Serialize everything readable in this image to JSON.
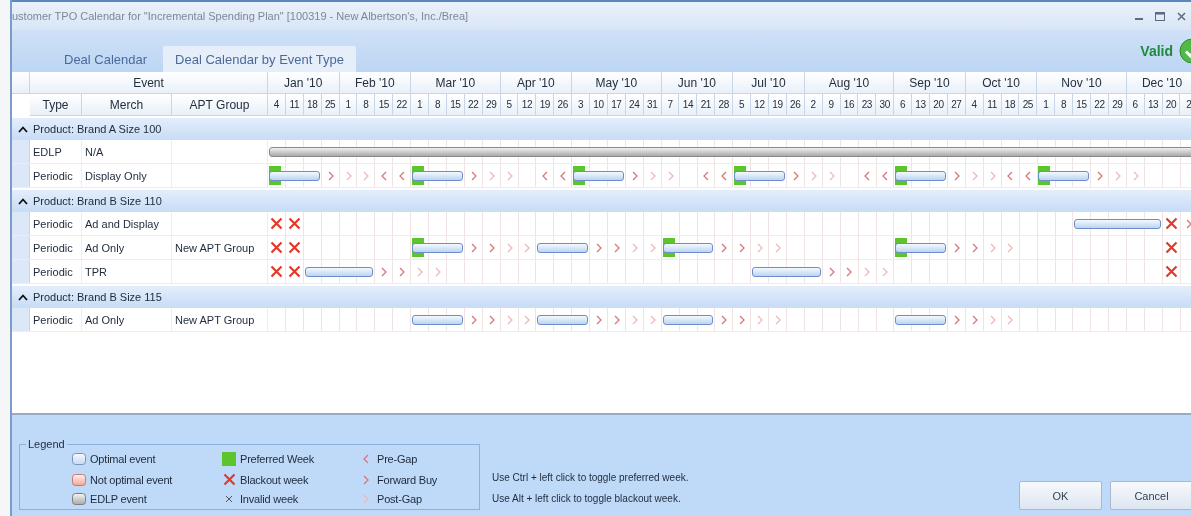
{
  "window": {
    "title": "ustomer TPO Calendar for \"Incremental Spending Plan\" [100319 - New Albertson's, Inc./Brea]"
  },
  "tabs": [
    {
      "label": "Deal Calendar",
      "selected": false
    },
    {
      "label": "Deal Calendar by Event Type",
      "selected": true
    }
  ],
  "status": {
    "label": "Valid",
    "valid": true
  },
  "table": {
    "event_header": "Event",
    "columns": [
      "Type",
      "Merch",
      "APT Group"
    ],
    "months": [
      {
        "label": "Jan '10",
        "weeks": [
          "4",
          "11",
          "18",
          "25"
        ]
      },
      {
        "label": "Feb '10",
        "weeks": [
          "1",
          "8",
          "15",
          "22"
        ]
      },
      {
        "label": "Mar '10",
        "weeks": [
          "1",
          "8",
          "15",
          "22",
          "29"
        ]
      },
      {
        "label": "Apr '10",
        "weeks": [
          "5",
          "12",
          "19",
          "26"
        ]
      },
      {
        "label": "May '10",
        "weeks": [
          "3",
          "10",
          "17",
          "24",
          "31"
        ]
      },
      {
        "label": "Jun '10",
        "weeks": [
          "7",
          "14",
          "21",
          "28"
        ]
      },
      {
        "label": "Jul '10",
        "weeks": [
          "5",
          "12",
          "19",
          "26"
        ]
      },
      {
        "label": "Aug '10",
        "weeks": [
          "2",
          "9",
          "16",
          "23",
          "30"
        ]
      },
      {
        "label": "Sep '10",
        "weeks": [
          "6",
          "13",
          "20",
          "27"
        ]
      },
      {
        "label": "Oct '10",
        "weeks": [
          "4",
          "11",
          "18",
          "25"
        ]
      },
      {
        "label": "Nov '10",
        "weeks": [
          "1",
          "8",
          "15",
          "22",
          "29"
        ]
      },
      {
        "label": "Dec '10",
        "weeks": [
          "6",
          "13",
          "20",
          "2"
        ]
      }
    ],
    "groups": [
      {
        "label": "Product: Brand A Size 100",
        "expanded": true,
        "rows": [
          {
            "type": "EDLP",
            "merch": "N/A",
            "weeks": [
              {
                "kind": "edlp"
              },
              {
                "kind": "cont"
              },
              {
                "kind": "cont"
              },
              {
                "kind": "cont"
              },
              {
                "kind": "cont"
              },
              {
                "kind": "cont"
              },
              {
                "kind": "cont"
              },
              {
                "kind": "cont"
              },
              {
                "kind": "cont"
              },
              {
                "kind": "cont"
              },
              {
                "kind": "cont"
              },
              {
                "kind": "cont"
              },
              {
                "kind": "cont"
              },
              {
                "kind": "cont"
              },
              {
                "kind": "cont"
              },
              {
                "kind": "cont"
              },
              {
                "kind": "cont"
              },
              {
                "kind": "cont"
              },
              {
                "kind": "cont"
              },
              {
                "kind": "cont"
              },
              {
                "kind": "cont"
              },
              {
                "kind": "cont"
              },
              {
                "kind": "cont"
              },
              {
                "kind": "cont"
              },
              {
                "kind": "cont"
              },
              {
                "kind": "cont"
              },
              {
                "kind": "cont"
              },
              {
                "kind": "cont"
              },
              {
                "kind": "cont"
              },
              {
                "kind": "cont"
              },
              {
                "kind": "cont"
              },
              {
                "kind": "cont"
              },
              {
                "kind": "cont"
              },
              {
                "kind": "cont"
              },
              {
                "kind": "cont"
              },
              {
                "kind": "cont"
              },
              {
                "kind": "cont"
              },
              {
                "kind": "cont"
              },
              {
                "kind": "cont"
              },
              {
                "kind": "cont"
              },
              {
                "kind": "cont"
              },
              {
                "kind": "cont"
              },
              {
                "kind": "cont"
              },
              {
                "kind": "cont"
              },
              {
                "kind": "cont"
              },
              {
                "kind": "cont"
              },
              {
                "kind": "cont"
              },
              {
                "kind": "cont"
              },
              {
                "kind": "cont"
              },
              {
                "kind": "cont"
              },
              {
                "kind": "cont"
              },
              {
                "kind": "cont"
              }
            ]
          },
          {
            "type": "Periodic",
            "merch": "Display Only",
            "weeks": [
              {
                "kind": "preferred"
              },
              {
                "kind": "cont"
              },
              {
                "kind": "cont"
              },
              {
                "kind": "fwd"
              },
              {
                "kind": "post"
              },
              {
                "kind": "post"
              },
              {
                "kind": "pre"
              },
              {
                "kind": "pre"
              },
              {
                "kind": "preferred"
              },
              {
                "kind": "cont"
              },
              {
                "kind": "cont"
              },
              {
                "kind": "fwd"
              },
              {
                "kind": "post"
              },
              {
                "kind": "post"
              },
              {
                "kind": "none"
              },
              {
                "kind": "pre"
              },
              {
                "kind": "pre"
              },
              {
                "kind": "preferred"
              },
              {
                "kind": "cont"
              },
              {
                "kind": "cont"
              },
              {
                "kind": "fwd"
              },
              {
                "kind": "post"
              },
              {
                "kind": "post"
              },
              {
                "kind": "none"
              },
              {
                "kind": "pre"
              },
              {
                "kind": "pre"
              },
              {
                "kind": "preferred"
              },
              {
                "kind": "cont"
              },
              {
                "kind": "cont"
              },
              {
                "kind": "fwd"
              },
              {
                "kind": "post"
              },
              {
                "kind": "post"
              },
              {
                "kind": "none"
              },
              {
                "kind": "pre"
              },
              {
                "kind": "pre"
              },
              {
                "kind": "preferred"
              },
              {
                "kind": "cont"
              },
              {
                "kind": "cont"
              },
              {
                "kind": "fwd"
              },
              {
                "kind": "post"
              },
              {
                "kind": "post"
              },
              {
                "kind": "pre"
              },
              {
                "kind": "pre"
              },
              {
                "kind": "preferred"
              },
              {
                "kind": "cont"
              },
              {
                "kind": "cont"
              },
              {
                "kind": "fwd"
              },
              {
                "kind": "post"
              },
              {
                "kind": "post"
              },
              {
                "kind": "none"
              },
              {
                "kind": "none"
              },
              {
                "kind": "none"
              }
            ]
          }
        ]
      },
      {
        "label": "Product: Brand B Size 110",
        "expanded": true,
        "rows": [
          {
            "type": "Periodic",
            "merch": "Ad and Display",
            "weeks": [
              {
                "kind": "blackout"
              },
              {
                "kind": "blackout"
              },
              {
                "kind": "none"
              },
              {
                "kind": "none"
              },
              {
                "kind": "none"
              },
              {
                "kind": "none"
              },
              {
                "kind": "none"
              },
              {
                "kind": "none"
              },
              {
                "kind": "none"
              },
              {
                "kind": "none"
              },
              {
                "kind": "none"
              },
              {
                "kind": "none"
              },
              {
                "kind": "none"
              },
              {
                "kind": "none"
              },
              {
                "kind": "none"
              },
              {
                "kind": "none"
              },
              {
                "kind": "none"
              },
              {
                "kind": "none"
              },
              {
                "kind": "none"
              },
              {
                "kind": "none"
              },
              {
                "kind": "none"
              },
              {
                "kind": "none"
              },
              {
                "kind": "none"
              },
              {
                "kind": "none"
              },
              {
                "kind": "none"
              },
              {
                "kind": "none"
              },
              {
                "kind": "none"
              },
              {
                "kind": "none"
              },
              {
                "kind": "none"
              },
              {
                "kind": "none"
              },
              {
                "kind": "none"
              },
              {
                "kind": "none"
              },
              {
                "kind": "none"
              },
              {
                "kind": "none"
              },
              {
                "kind": "none"
              },
              {
                "kind": "none"
              },
              {
                "kind": "none"
              },
              {
                "kind": "none"
              },
              {
                "kind": "none"
              },
              {
                "kind": "none"
              },
              {
                "kind": "none"
              },
              {
                "kind": "none"
              },
              {
                "kind": "none"
              },
              {
                "kind": "none"
              },
              {
                "kind": "none"
              },
              {
                "kind": "optimal"
              },
              {
                "kind": "cont"
              },
              {
                "kind": "cont"
              },
              {
                "kind": "cont"
              },
              {
                "kind": "cont"
              },
              {
                "kind": "blackout"
              },
              {
                "kind": "fwd"
              }
            ]
          },
          {
            "type": "Periodic",
            "merch": "Ad Only",
            "apt_group": "New APT Group",
            "weeks": [
              {
                "kind": "blackout"
              },
              {
                "kind": "blackout"
              },
              {
                "kind": "none"
              },
              {
                "kind": "none"
              },
              {
                "kind": "none"
              },
              {
                "kind": "none"
              },
              {
                "kind": "none"
              },
              {
                "kind": "none"
              },
              {
                "kind": "preferred"
              },
              {
                "kind": "cont"
              },
              {
                "kind": "cont"
              },
              {
                "kind": "fwd"
              },
              {
                "kind": "fwd"
              },
              {
                "kind": "post"
              },
              {
                "kind": "post"
              },
              {
                "kind": "optimal"
              },
              {
                "kind": "cont"
              },
              {
                "kind": "cont"
              },
              {
                "kind": "fwd"
              },
              {
                "kind": "fwd"
              },
              {
                "kind": "post"
              },
              {
                "kind": "post"
              },
              {
                "kind": "preferred"
              },
              {
                "kind": "cont"
              },
              {
                "kind": "cont"
              },
              {
                "kind": "fwd"
              },
              {
                "kind": "fwd"
              },
              {
                "kind": "post"
              },
              {
                "kind": "post"
              },
              {
                "kind": "none"
              },
              {
                "kind": "none"
              },
              {
                "kind": "none"
              },
              {
                "kind": "none"
              },
              {
                "kind": "none"
              },
              {
                "kind": "none"
              },
              {
                "kind": "preferred"
              },
              {
                "kind": "cont"
              },
              {
                "kind": "cont"
              },
              {
                "kind": "fwd"
              },
              {
                "kind": "fwd"
              },
              {
                "kind": "post"
              },
              {
                "kind": "post"
              },
              {
                "kind": "none"
              },
              {
                "kind": "none"
              },
              {
                "kind": "none"
              },
              {
                "kind": "none"
              },
              {
                "kind": "none"
              },
              {
                "kind": "none"
              },
              {
                "kind": "none"
              },
              {
                "kind": "none"
              },
              {
                "kind": "blackout"
              },
              {
                "kind": "none"
              }
            ]
          },
          {
            "type": "Periodic",
            "merch": "TPR",
            "weeks": [
              {
                "kind": "blackout"
              },
              {
                "kind": "blackout"
              },
              {
                "kind": "optimal"
              },
              {
                "kind": "cont"
              },
              {
                "kind": "cont"
              },
              {
                "kind": "cont"
              },
              {
                "kind": "fwd"
              },
              {
                "kind": "fwd"
              },
              {
                "kind": "post"
              },
              {
                "kind": "post"
              },
              {
                "kind": "none"
              },
              {
                "kind": "none"
              },
              {
                "kind": "none"
              },
              {
                "kind": "none"
              },
              {
                "kind": "none"
              },
              {
                "kind": "none"
              },
              {
                "kind": "none"
              },
              {
                "kind": "none"
              },
              {
                "kind": "none"
              },
              {
                "kind": "none"
              },
              {
                "kind": "none"
              },
              {
                "kind": "none"
              },
              {
                "kind": "none"
              },
              {
                "kind": "none"
              },
              {
                "kind": "none"
              },
              {
                "kind": "none"
              },
              {
                "kind": "none"
              },
              {
                "kind": "optimal"
              },
              {
                "kind": "cont"
              },
              {
                "kind": "cont"
              },
              {
                "kind": "cont"
              },
              {
                "kind": "fwd"
              },
              {
                "kind": "fwd"
              },
              {
                "kind": "post"
              },
              {
                "kind": "post"
              },
              {
                "kind": "none"
              },
              {
                "kind": "none"
              },
              {
                "kind": "none"
              },
              {
                "kind": "none"
              },
              {
                "kind": "none"
              },
              {
                "kind": "none"
              },
              {
                "kind": "none"
              },
              {
                "kind": "none"
              },
              {
                "kind": "none"
              },
              {
                "kind": "none"
              },
              {
                "kind": "none"
              },
              {
                "kind": "none"
              },
              {
                "kind": "none"
              },
              {
                "kind": "none"
              },
              {
                "kind": "none"
              },
              {
                "kind": "blackout"
              },
              {
                "kind": "none"
              }
            ]
          }
        ]
      },
      {
        "label": "Product: Brand B Size 115",
        "expanded": true,
        "rows": [
          {
            "type": "Periodic",
            "merch": "Ad Only",
            "apt_group": "New APT Group",
            "weeks": [
              {
                "kind": "none"
              },
              {
                "kind": "none"
              },
              {
                "kind": "none"
              },
              {
                "kind": "none"
              },
              {
                "kind": "none"
              },
              {
                "kind": "none"
              },
              {
                "kind": "none"
              },
              {
                "kind": "none"
              },
              {
                "kind": "optimal"
              },
              {
                "kind": "cont"
              },
              {
                "kind": "cont"
              },
              {
                "kind": "fwd"
              },
              {
                "kind": "fwd"
              },
              {
                "kind": "post"
              },
              {
                "kind": "post"
              },
              {
                "kind": "optimal"
              },
              {
                "kind": "cont"
              },
              {
                "kind": "cont"
              },
              {
                "kind": "fwd"
              },
              {
                "kind": "fwd"
              },
              {
                "kind": "post"
              },
              {
                "kind": "post"
              },
              {
                "kind": "optimal"
              },
              {
                "kind": "cont"
              },
              {
                "kind": "cont"
              },
              {
                "kind": "fwd"
              },
              {
                "kind": "fwd"
              },
              {
                "kind": "post"
              },
              {
                "kind": "post"
              },
              {
                "kind": "none"
              },
              {
                "kind": "none"
              },
              {
                "kind": "none"
              },
              {
                "kind": "none"
              },
              {
                "kind": "none"
              },
              {
                "kind": "none"
              },
              {
                "kind": "optimal"
              },
              {
                "kind": "cont"
              },
              {
                "kind": "cont"
              },
              {
                "kind": "fwd"
              },
              {
                "kind": "fwd"
              },
              {
                "kind": "post"
              },
              {
                "kind": "post"
              },
              {
                "kind": "none"
              },
              {
                "kind": "none"
              },
              {
                "kind": "none"
              },
              {
                "kind": "none"
              },
              {
                "kind": "none"
              },
              {
                "kind": "none"
              },
              {
                "kind": "none"
              },
              {
                "kind": "none"
              },
              {
                "kind": "none"
              },
              {
                "kind": "none"
              }
            ]
          }
        ]
      }
    ]
  },
  "legend": {
    "title": "Legend",
    "items": [
      {
        "kind": "optimal",
        "label": "Optimal event"
      },
      {
        "kind": "preferred",
        "label": "Preferred Week"
      },
      {
        "kind": "pre",
        "label": "Pre-Gap"
      },
      {
        "kind": "not-optimal",
        "label": "Not optimal event"
      },
      {
        "kind": "blackout",
        "label": "Blackout week"
      },
      {
        "kind": "fwd",
        "label": "Forward Buy"
      },
      {
        "kind": "edlp",
        "label": "EDLP event"
      },
      {
        "kind": "invalid",
        "label": "Invalid week"
      },
      {
        "kind": "post",
        "label": "Post-Gap"
      }
    ]
  },
  "hints": [
    "Use Ctrl + left click to toggle preferred week.",
    "Use Alt + left click to toggle blackout week."
  ],
  "buttons": [
    "OK",
    "Cancel"
  ]
}
